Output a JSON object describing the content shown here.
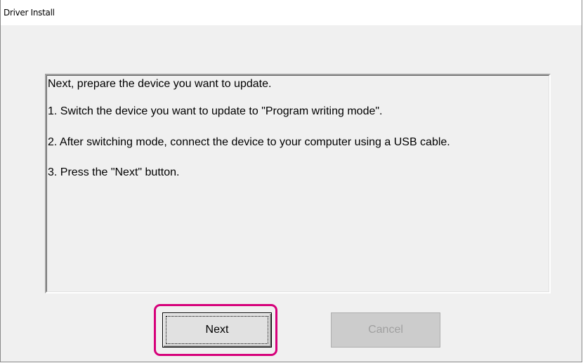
{
  "window": {
    "title": "Driver Install"
  },
  "message": {
    "lines": [
      "Next, prepare the device you want to update.",
      "1. Switch the device you want to update to \"Program writing mode\".",
      "2. After switching mode, connect the device to your computer using a USB cable.",
      "3. Press the \"Next\" button."
    ]
  },
  "buttons": {
    "next_label": "Next",
    "cancel_label": "Cancel"
  },
  "colors": {
    "highlight": "#d6007a",
    "dialog_background": "#f0f0f0"
  }
}
